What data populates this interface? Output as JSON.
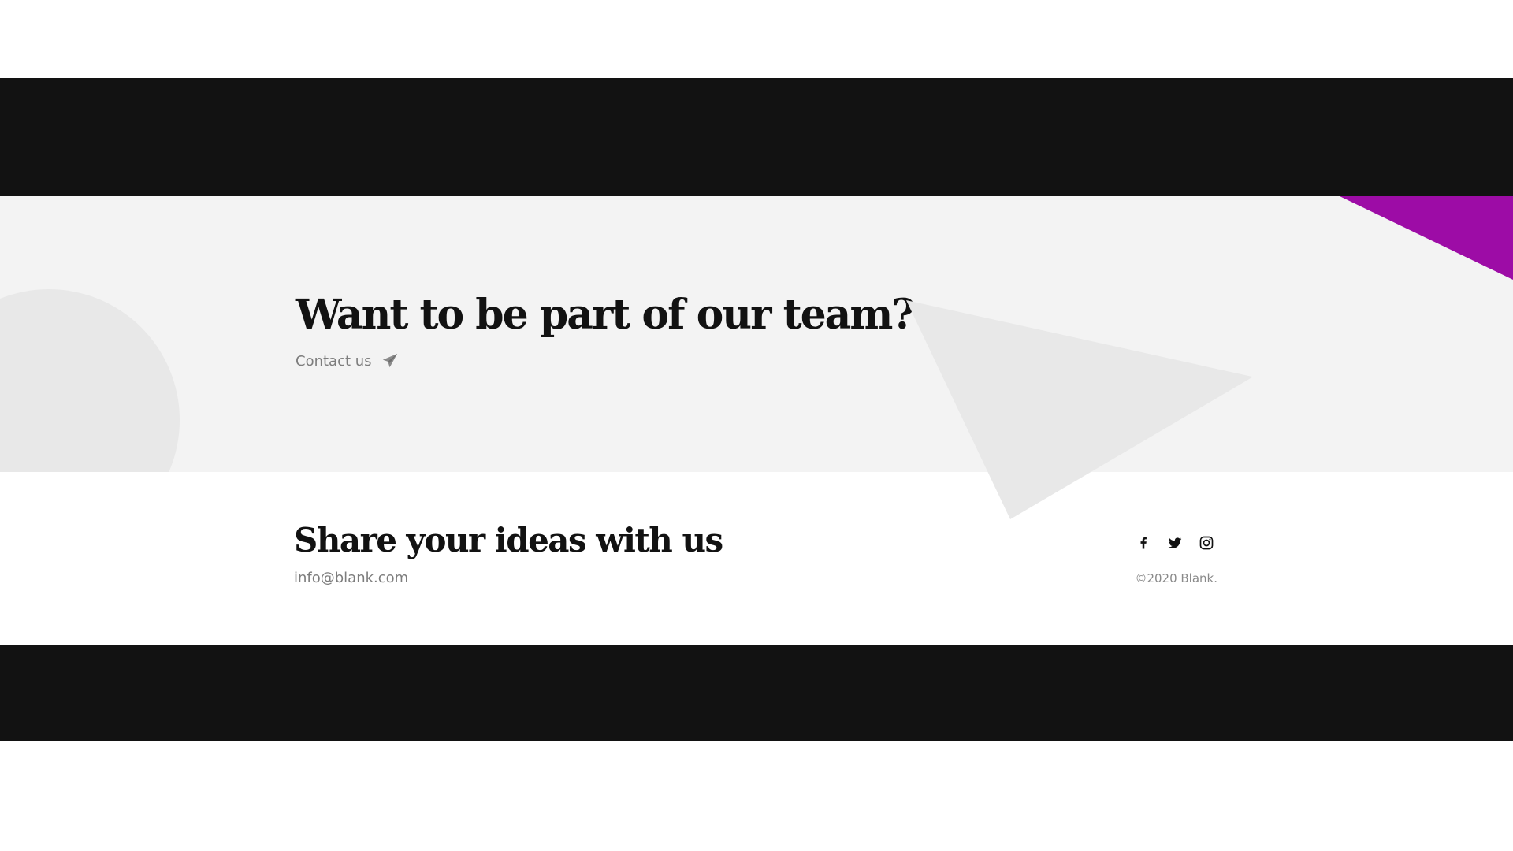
{
  "cta": {
    "title": "Want to be part of our team?",
    "contact_label": "Contact us",
    "contact_icon": "paper-plane-icon"
  },
  "footer": {
    "title": "Share your ideas with us",
    "email": "info@blank.com",
    "copyright": "©2020 Blank.",
    "social": [
      {
        "name": "facebook-icon"
      },
      {
        "name": "twitter-icon"
      },
      {
        "name": "instagram-icon"
      }
    ]
  },
  "colors": {
    "dark_bar": "#121212",
    "cta_background": "#f3f3f3",
    "accent": "#9d0ca6",
    "decor_gray": "#e8e8e8",
    "muted_text": "#7d7d7d"
  }
}
